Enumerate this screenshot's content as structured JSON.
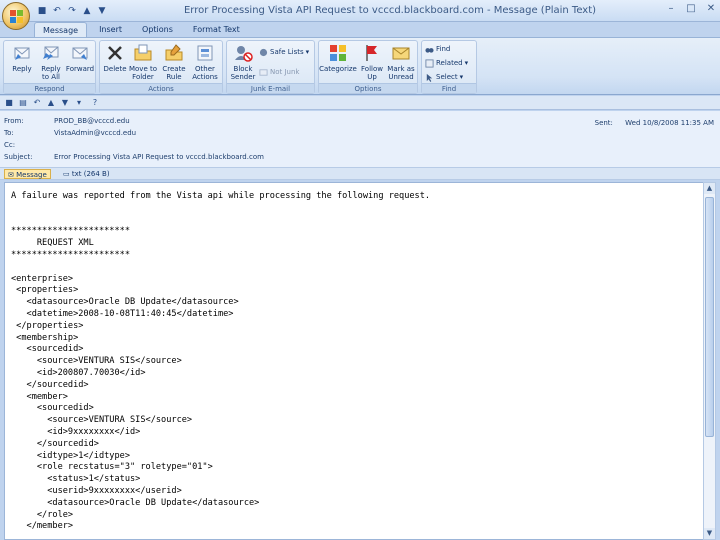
{
  "window": {
    "title": "Error Processing Vista API Request to vcccd.blackboard.com  -  Message (Plain Text)"
  },
  "tabs": [
    {
      "label": "Message"
    },
    {
      "label": "Insert"
    },
    {
      "label": "Options"
    },
    {
      "label": "Format Text"
    }
  ],
  "ribbon": {
    "respond": {
      "group_label": "Respond",
      "reply": "Reply",
      "reply_all_1": "Reply",
      "reply_all_2": "to All",
      "forward": "Forward"
    },
    "actions": {
      "group_label": "Actions",
      "delete": "Delete",
      "move_1": "Move to",
      "move_2": "Folder",
      "create_1": "Create",
      "create_2": "Rule",
      "other_1": "Other",
      "other_2": "Actions"
    },
    "junk": {
      "group_label": "Junk E-mail",
      "block_1": "Block",
      "block_2": "Sender",
      "safe_lists": "Safe Lists",
      "not_junk": "Not Junk"
    },
    "options": {
      "group_label": "Options",
      "categorize": "Categorize",
      "follow_1": "Follow",
      "follow_2": "Up",
      "mark_1": "Mark as",
      "mark_2": "Unread"
    },
    "find": {
      "group_label": "Find",
      "find": "Find",
      "related": "Related",
      "select": "Select"
    }
  },
  "header": {
    "from_label": "From:",
    "from_value": "PROD_BB@vcccd.edu",
    "to_label": "To:",
    "to_value": "VistaAdmin@vcccd.edu",
    "cc_label": "Cc:",
    "cc_value": "",
    "subject_label": "Subject:",
    "subject_value": "Error Processing Vista API Request to vcccd.blackboard.com",
    "sent_label": "Sent:",
    "sent_value": "Wed 10/8/2008 11:35 AM"
  },
  "attachments": [
    {
      "label": "Message"
    },
    {
      "label": "txt (264 B)"
    }
  ],
  "body_lines": [
    "A failure was reported from the Vista api while processing the following request.",
    "",
    "",
    "***********************",
    "     REQUEST XML",
    "***********************",
    "",
    "<enterprise>",
    " <properties>",
    "   <datasource>Oracle DB Update</datasource>",
    "   <datetime>2008-10-08T11:40:45</datetime>",
    " </properties>",
    " <membership>",
    "   <sourcedid>",
    "     <source>VENTURA SIS</source>",
    "     <id>200807.70030</id>",
    "   </sourcedid>",
    "   <member>",
    "     <sourcedid>",
    "       <source>VENTURA SIS</source>",
    "       <id>9xxxxxxxx</id>",
    "     </sourcedid>",
    "     <idtype>1</idtype>",
    "     <role recstatus=\"3\" roletype=\"01\">",
    "       <status>1</status>",
    "       <userid>9xxxxxxxx</userid>",
    "       <datasource>Oracle DB Update</datasource>",
    "     </role>",
    "   </member>"
  ],
  "colors": {
    "ribbon_bg": "#d4e3f5",
    "frame_bg": "#bfd3ee",
    "text_dark": "#15376b"
  }
}
